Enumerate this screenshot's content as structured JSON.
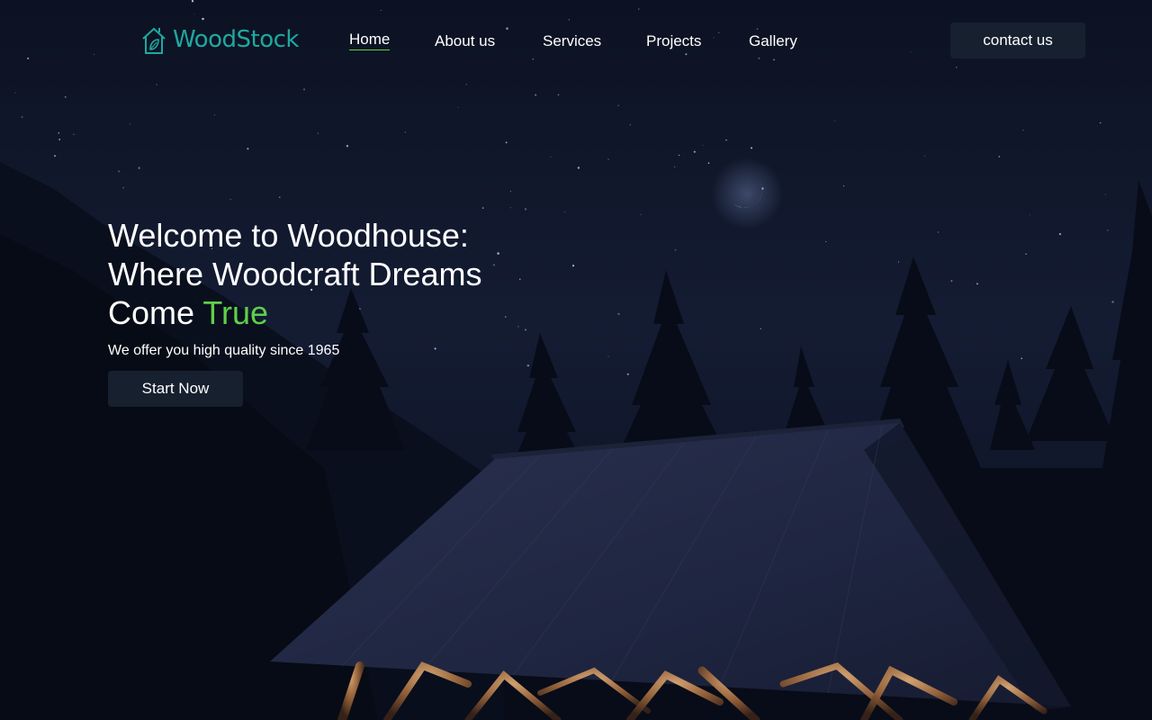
{
  "brand": {
    "name": "WoodStock",
    "icon": "house-leaf-icon",
    "color": "#1fa8a0"
  },
  "nav": {
    "items": [
      {
        "label": "Home",
        "active": true
      },
      {
        "label": "About us"
      },
      {
        "label": "Services"
      },
      {
        "label": "Projects"
      },
      {
        "label": "Gallery"
      }
    ],
    "active_underline_color": "#5fd04a"
  },
  "contact_label": "contact us",
  "hero": {
    "title_line1": "Welcome to Woodhouse:",
    "title_line2": "Where Woodcraft Dreams",
    "title_line3_prefix": "Come ",
    "title_accent": "True",
    "accent_color": "#5fd04a",
    "subtitle": "We offer you high quality since 1965",
    "cta_label": "Start Now"
  },
  "background": {
    "description_icons": [
      "crescent-moon-icon",
      "stars",
      "pine-trees",
      "wooden-cabin-roof"
    ],
    "sky_color": "#12192d"
  }
}
